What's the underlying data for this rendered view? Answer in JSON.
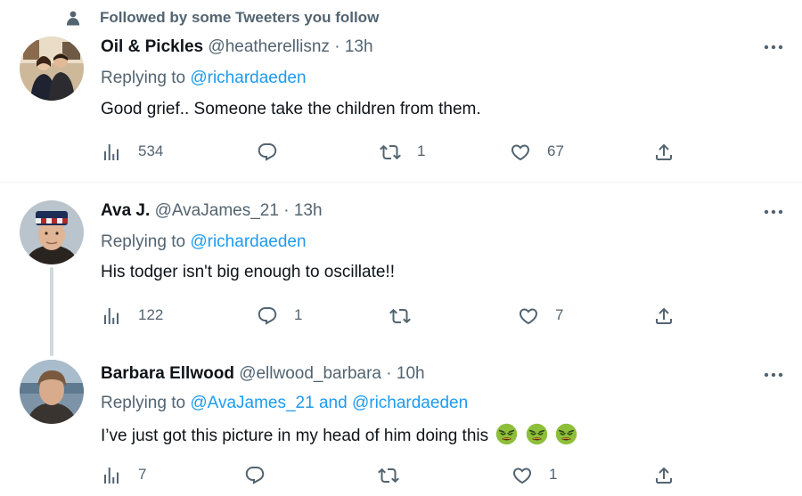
{
  "social_context": {
    "icon": "person-icon",
    "text": "Followed by some Tweeters you follow"
  },
  "tweets": [
    {
      "name": "Oil & Pickles",
      "handle": "@heatherellisnz",
      "separator": "·",
      "time": "13h",
      "replying_prefix": "Replying to",
      "replying_mentions": "@richardaeden",
      "text": "Good grief.. Someone take the children from them.",
      "views": "534",
      "replies": "",
      "retweets": "1",
      "likes": "67"
    },
    {
      "name": "Ava J.",
      "handle": "@AvaJames_21",
      "separator": "·",
      "time": "13h",
      "replying_prefix": "Replying to",
      "replying_mentions": "@richardaeden",
      "text": "His todger isn't big enough to oscillate!!",
      "views": "122",
      "replies": "1",
      "retweets": "",
      "likes": "7"
    },
    {
      "name": "Barbara Ellwood",
      "handle": "@ellwood_barbara",
      "separator": "·",
      "time": "10h",
      "replying_prefix": "Replying to",
      "replying_mentions": "@AvaJames_21 and @richardaeden",
      "text": "I’ve just got this picture in my head of him doing this",
      "emoji": "nauseated-face-emoji",
      "views": "7",
      "replies": "",
      "retweets": "",
      "likes": "1"
    }
  ],
  "colors": {
    "text_primary": "#0f1419",
    "text_secondary": "#536471",
    "link": "#1d9bf0",
    "divider": "#eff3f4",
    "thread_line": "#cfd9de"
  }
}
